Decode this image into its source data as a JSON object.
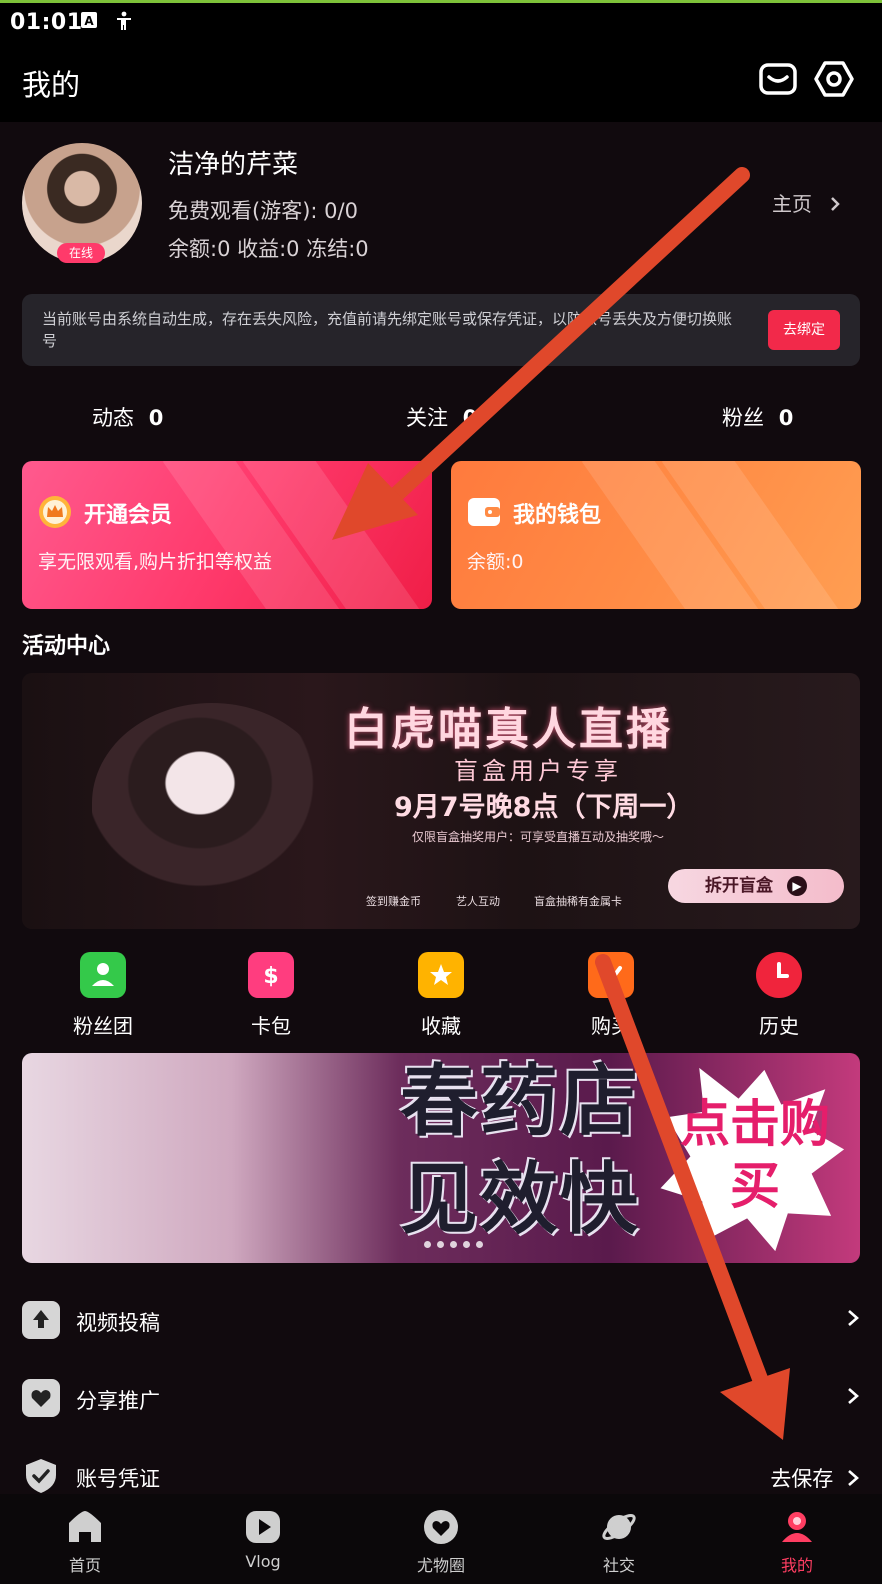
{
  "status_bar": {
    "time": "01:01",
    "icons": [
      "notification-a-icon",
      "accessibility-icon"
    ]
  },
  "header": {
    "title": "我的",
    "mail_icon": "mail-icon",
    "settings_icon": "settings-hex-icon"
  },
  "profile": {
    "name": "洁净的芹菜",
    "online_badge": "在线",
    "free_views": "免费观看(游客): 0/0",
    "balance_line": "余额:0 收益:0 冻结:0",
    "home_link": "主页"
  },
  "notice": {
    "text": "当前账号由系统自动生成，存在丢失风险，充值前请先绑定账号或保存凭证，以防账号丢失及方便切换账号",
    "button": "去绑定"
  },
  "stats": [
    {
      "label": "动态",
      "value": "0"
    },
    {
      "label": "关注",
      "value": "0"
    },
    {
      "label": "粉丝",
      "value": "0"
    }
  ],
  "cards": {
    "vip": {
      "title": "开通会员",
      "subtitle": "享无限观看,购片折扣等权益"
    },
    "wallet": {
      "title": "我的钱包",
      "subtitle": "余额:0"
    }
  },
  "activity": {
    "title": "活动中心"
  },
  "banner1": {
    "title": "白虎喵真人直播",
    "subtitle": "盲盒用户专享",
    "date": "9月7号晚8点（下周一）",
    "note": "仅限盲盒抽奖用户：可享受直播互动及抽奖哦～",
    "features": [
      "签到赚金币",
      "艺人互动",
      "盲盒抽稀有金属卡"
    ],
    "button": "拆开盲盒"
  },
  "quick_actions": [
    {
      "label": "粉丝团",
      "icon": "fans-group-icon",
      "color": "#34c94a"
    },
    {
      "label": "卡包",
      "icon": "card-pack-icon",
      "color": "#ff3d7f"
    },
    {
      "label": "收藏",
      "icon": "favorite-icon",
      "color": "#ffb300"
    },
    {
      "label": "购买",
      "icon": "purchase-icon",
      "color": "#ff6a1a"
    },
    {
      "label": "历史",
      "icon": "history-icon",
      "color": "#f0243c"
    }
  ],
  "banner2": {
    "line1": "春药店",
    "line2": "见效快",
    "cta": "点击购买"
  },
  "menu": [
    {
      "label": "视频投稿",
      "icon": "upload-icon",
      "right": ""
    },
    {
      "label": "分享推广",
      "icon": "share-icon",
      "right": ""
    },
    {
      "label": "账号凭证",
      "icon": "shield-check-icon",
      "right": "去保存"
    }
  ],
  "tabs": [
    {
      "label": "首页",
      "icon": "home-icon",
      "active": false
    },
    {
      "label": "Vlog",
      "icon": "play-icon",
      "active": false
    },
    {
      "label": "尤物圈",
      "icon": "heart-circle-icon",
      "active": false
    },
    {
      "label": "社交",
      "icon": "planet-icon",
      "active": false
    },
    {
      "label": "我的",
      "icon": "profile-icon",
      "active": true
    }
  ],
  "colors": {
    "accent": "#ff3e62",
    "background": "#110a0e",
    "annotation_arrow": "#e0482b"
  }
}
